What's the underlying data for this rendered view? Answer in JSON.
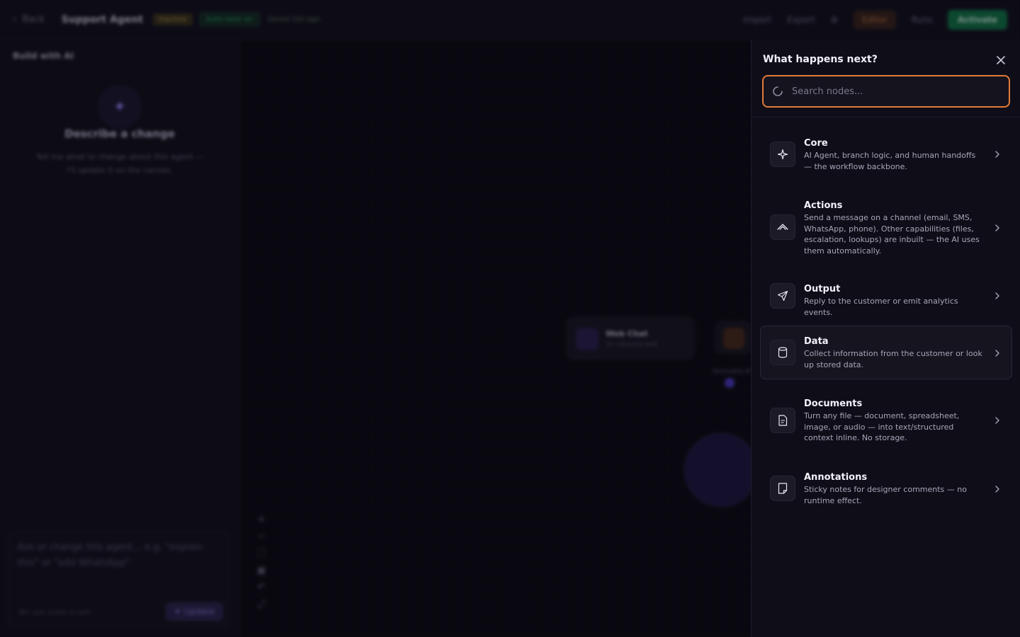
{
  "topbar": {
    "back_label": "Back",
    "title": "Support Agent",
    "status_badge": "Inactive",
    "autosave_badge": "Auto-save on",
    "saved_text": "Saved 10s ago",
    "import_label": "Import",
    "export_label": "Export",
    "editor_label": "Editor",
    "runs_label": "Runs",
    "activate_label": "Activate"
  },
  "left_panel": {
    "header": "Build with AI",
    "title": "Describe a change",
    "description": "Tell me what to change about this agent — I'll update it on the canvas.",
    "chat_placeholder": "Ask or change this agent… e.g. \"explain this\" or \"add WhatsApp\"",
    "chat_hint": "⌘↵ use, builds or edit",
    "update_button": "✦ Update"
  },
  "canvas": {
    "node_web_title": "Web Chat",
    "node_web_sub": "On inbound web",
    "edge_label": "Personality M",
    "zoom_controls": [
      "+",
      "−",
      "⛶",
      "▣",
      "↶",
      "⤢"
    ]
  },
  "node_picker": {
    "title": "What happens next?",
    "search_placeholder": "Search nodes...",
    "search_value": "",
    "categories": [
      {
        "name": "Core",
        "icon": "sparkle-icon",
        "description": "AI Agent, branch logic, and human handoffs — the workflow backbone."
      },
      {
        "name": "Actions",
        "icon": "wave-icon",
        "description": "Send a message on a channel (email, SMS, WhatsApp, phone). Other capabilities (files, escalation, lookups) are inbuilt — the AI uses them automatically."
      },
      {
        "name": "Output",
        "icon": "send-icon",
        "description": "Reply to the customer or emit analytics events."
      },
      {
        "name": "Data",
        "icon": "database-icon",
        "description": "Collect information from the customer or look up stored data.",
        "highlighted": true
      },
      {
        "name": "Documents",
        "icon": "document-icon",
        "description": "Turn any file — document, spreadsheet, image, or audio — into text/structured context inline. No storage."
      },
      {
        "name": "Annotations",
        "icon": "note-icon",
        "description": "Sticky notes for designer comments — no runtime effect."
      }
    ]
  },
  "colors": {
    "accent_orange": "#e27a38",
    "panel_bg": "#0f0e18",
    "activate_green": "#0d7a48"
  }
}
